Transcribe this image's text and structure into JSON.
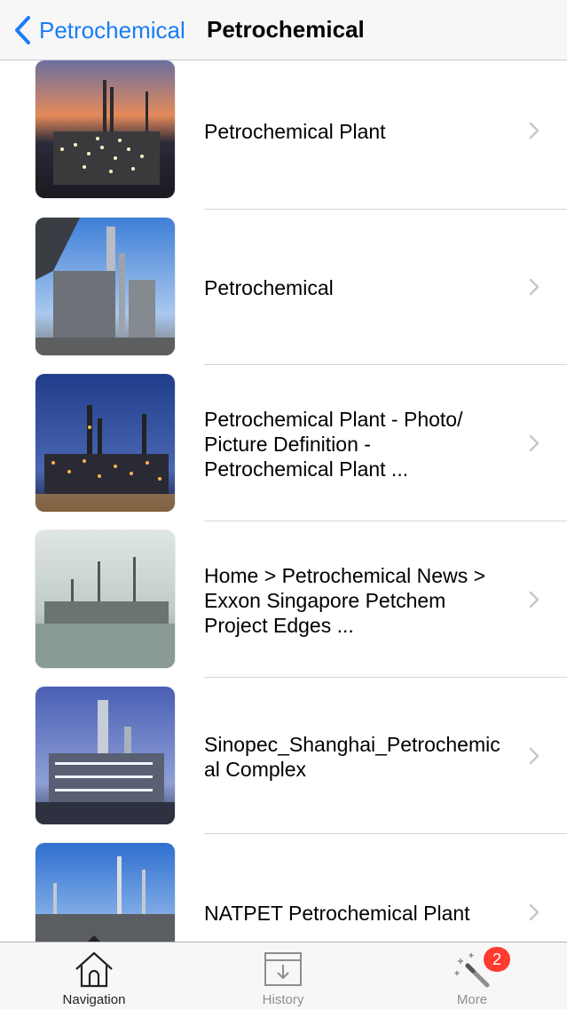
{
  "navbar": {
    "back_label": "Petrochemical",
    "title": "Petrochemical"
  },
  "list": {
    "items": [
      {
        "label": "Petrochemical Plant",
        "image": "refinery-sunset-thumbnail"
      },
      {
        "label": "Petrochemical",
        "image": "refinery-daytime-thumbnail"
      },
      {
        "label": "Petrochemical Plant - Photo/\nPicture Definition -\nPetrochemical Plant ...",
        "image": "refinery-night-thumbnail"
      },
      {
        "label": "Home > Petrochemical News >\nExxon Singapore Petchem\nProject Edges ...",
        "image": "refinery-waterfront-thumbnail"
      },
      {
        "label": "Sinopec_Shanghai_Petrochemic\nal Complex",
        "image": "refinery-dusk-thumbnail"
      },
      {
        "label": "NATPET Petrochemical Plant",
        "image": "refinery-towers-thumbnail"
      }
    ]
  },
  "tabbar": {
    "tabs": [
      {
        "label": "Navigation",
        "icon": "home-icon",
        "selected": true
      },
      {
        "label": "History",
        "icon": "inbox-download-icon",
        "selected": false
      },
      {
        "label": "More",
        "icon": "magic-wand-icon",
        "selected": false
      }
    ],
    "more_badge": "2"
  },
  "colors": {
    "accent": "#1a7cf5",
    "badge": "#ff3b30",
    "tab_selected": "#222222",
    "tab_unselected": "#8e8e93"
  }
}
